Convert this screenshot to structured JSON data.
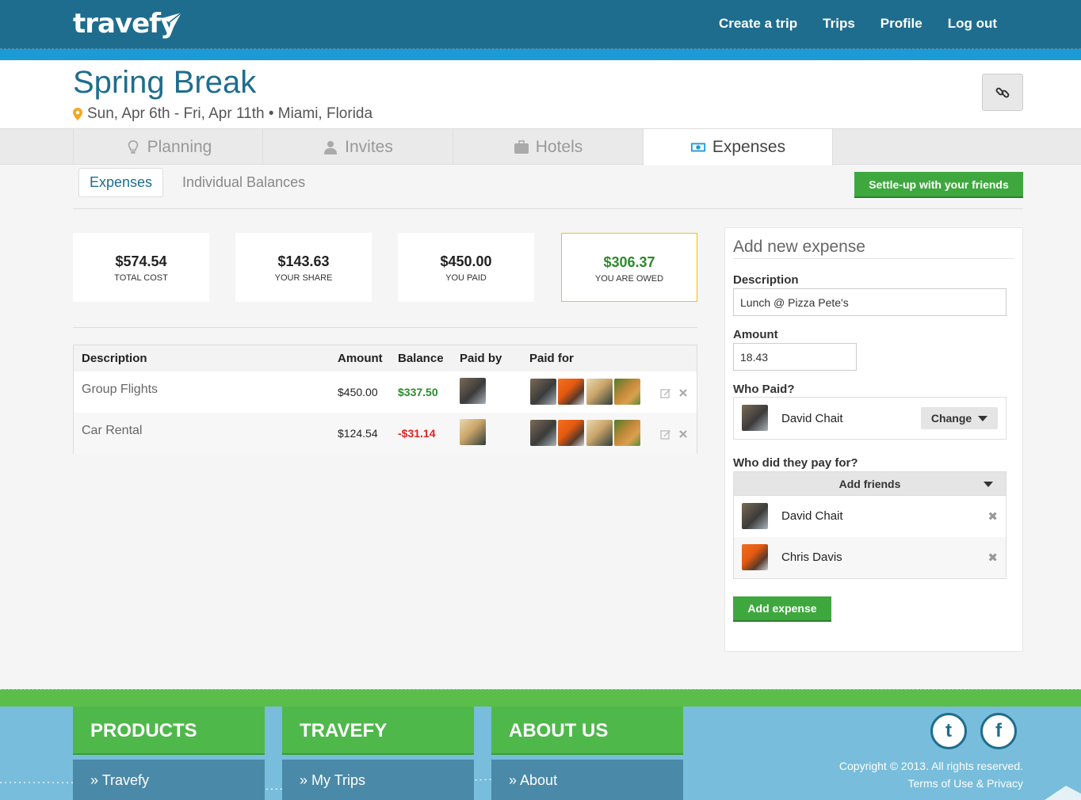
{
  "header": {
    "logo": "travefy",
    "nav": [
      "Create a trip",
      "Trips",
      "Profile",
      "Log out"
    ]
  },
  "trip": {
    "title": "Spring Break",
    "subtitle": "Sun, Apr 6th - Fri, Apr 11th • Miami, Florida"
  },
  "tabs": [
    {
      "label": "Planning",
      "icon": "lightbulb-icon"
    },
    {
      "label": "Invites",
      "icon": "user-icon"
    },
    {
      "label": "Hotels",
      "icon": "suitcase-icon"
    },
    {
      "label": "Expenses",
      "icon": "money-icon",
      "active": true
    }
  ],
  "subnav": {
    "expenses": "Expenses",
    "balances": "Individual Balances",
    "settle": "Settle-up with your friends"
  },
  "summary": [
    {
      "value": "$574.54",
      "label": "TOTAL COST"
    },
    {
      "value": "$143.63",
      "label": "YOUR SHARE"
    },
    {
      "value": "$450.00",
      "label": "YOU PAID"
    },
    {
      "value": "$306.37",
      "label": "YOU ARE OWED"
    }
  ],
  "table": {
    "headers": [
      "Description",
      "Amount",
      "Balance",
      "Paid by",
      "Paid for"
    ],
    "rows": [
      {
        "description": "Group Flights",
        "amount": "$450.00",
        "balance": "$337.50",
        "balance_status": "positive"
      },
      {
        "description": "Car Rental",
        "amount": "$124.54",
        "balance": "-$31.14",
        "balance_status": "negative"
      }
    ]
  },
  "add_expense": {
    "title": "Add new expense",
    "description_label": "Description",
    "description_value": "Lunch @ Pizza Pete's",
    "amount_label": "Amount",
    "amount_value": "18.43",
    "who_paid_label": "Who Paid?",
    "payer_name": "David Chait",
    "change_label": "Change",
    "who_for_label": "Who did they pay for?",
    "add_friends_label": "Add friends",
    "friends": [
      "David Chait",
      "Chris Davis"
    ],
    "remove_glyph": "✖",
    "submit_label": "Add expense"
  },
  "footer": {
    "columns": [
      {
        "heading": "PRODUCTS",
        "item": "Travefy"
      },
      {
        "heading": "TRAVEFY",
        "item": "My Trips"
      },
      {
        "heading": "ABOUT US",
        "item": "About"
      }
    ],
    "item_prefix": "»",
    "copyright": "Copyright © 2013. All rights reserved.",
    "terms": "Terms of Use & Privacy",
    "twitter_glyph": "t",
    "facebook_glyph": "f"
  },
  "colors": {
    "brand_blue": "#1f6d8e",
    "accent_blue": "#1c9ad6",
    "green": "#3ea83e",
    "owed_border": "#f2c200",
    "negative": "#e02222"
  }
}
